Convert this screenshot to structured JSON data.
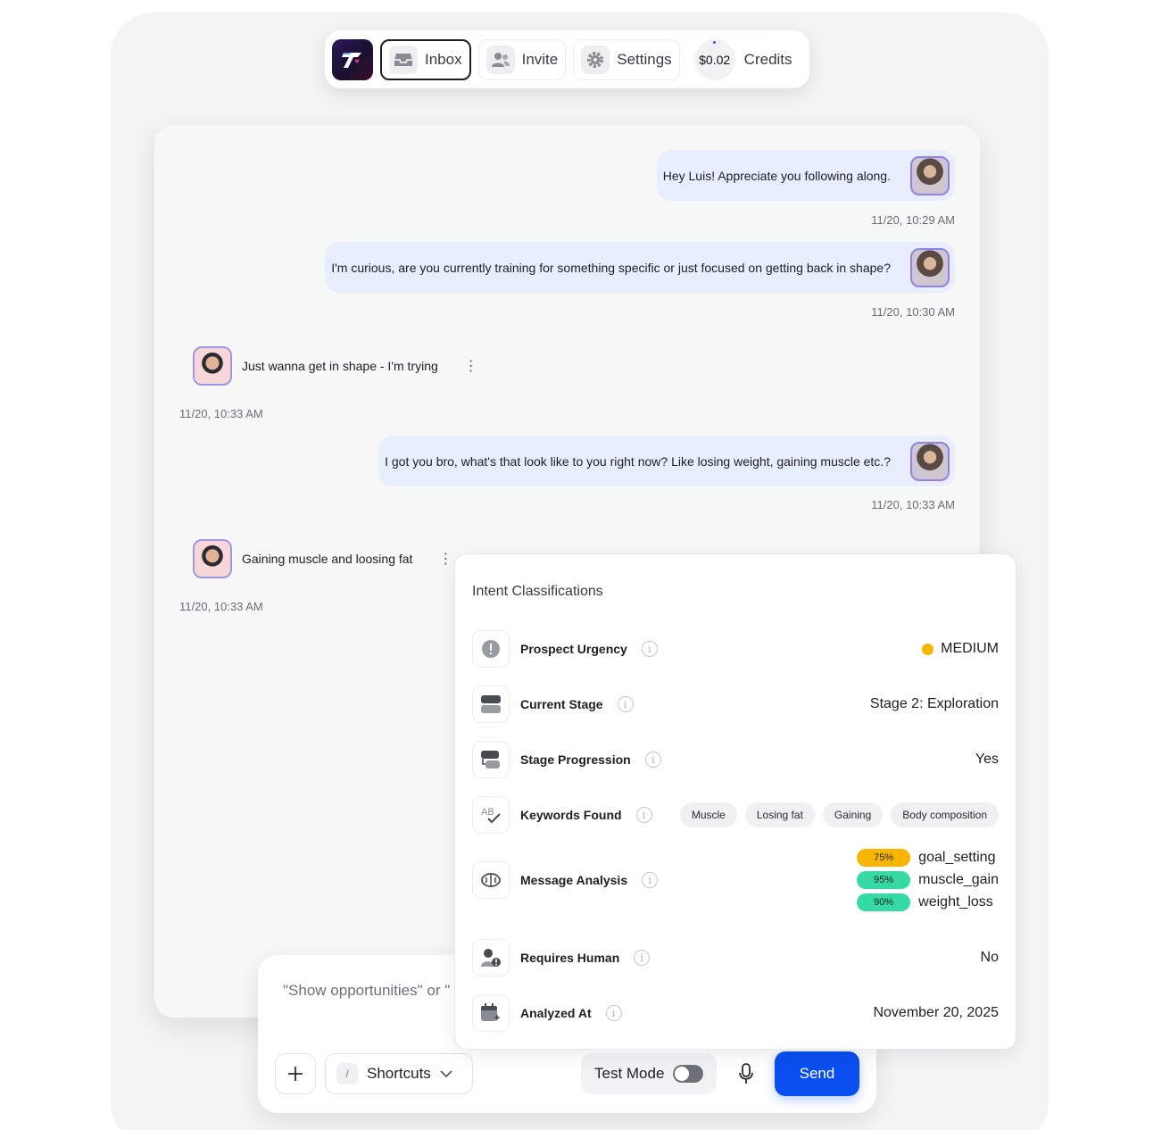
{
  "nav": {
    "inbox_label": "Inbox",
    "invite_label": "Invite",
    "settings_label": "Settings",
    "credit_value": "$0.02",
    "credits_label": "Credits"
  },
  "messages": [
    {
      "direction": "outgoing",
      "text": "Hey Luis! Appreciate you following along.",
      "time": "11/20, 10:29 AM"
    },
    {
      "direction": "outgoing",
      "text": "I'm curious, are you currently training for something specific or just focused on getting back in shape?",
      "time": "11/20, 10:30 AM"
    },
    {
      "direction": "incoming",
      "text": "Just wanna get in shape - I'm trying",
      "time": "11/20, 10:33 AM"
    },
    {
      "direction": "outgoing",
      "text": "I got you bro, what's that look like to you right now? Like losing weight, gaining muscle etc.?",
      "time": "11/20, 10:33 AM"
    },
    {
      "direction": "incoming",
      "text": "Gaining muscle and loosing fat",
      "time": "11/20, 10:33 AM"
    }
  ],
  "composer": {
    "placeholder": "\"Show opportunities\" or \"",
    "shortcut_key": "/",
    "shortcuts_label": "Shortcuts",
    "test_mode_label": "Test Mode",
    "test_mode_on": false,
    "send_label": "Send"
  },
  "intent": {
    "title": "Intent Classifications",
    "urgency_label": "Prospect Urgency",
    "urgency_value": "MEDIUM",
    "urgency_color": "#f7b500",
    "stage_label": "Current Stage",
    "stage_value": "Stage 2: Exploration",
    "progression_label": "Stage Progression",
    "progression_value": "Yes",
    "keywords_label": "Keywords Found",
    "keywords": [
      "Muscle",
      "Losing fat",
      "Gaining",
      "Body composition"
    ],
    "analysis_label": "Message Analysis",
    "analysis": [
      {
        "pct": "75%",
        "label": "goal_setting",
        "color": "#f7b500"
      },
      {
        "pct": "95%",
        "label": "muscle_gain",
        "color": "#34d9a4"
      },
      {
        "pct": "90%",
        "label": "weight_loss",
        "color": "#34d9a4"
      }
    ],
    "human_label": "Requires Human",
    "human_value": "No",
    "analyzed_label": "Analyzed At",
    "analyzed_value": "November 20, 2025"
  },
  "colors": {
    "accent": "#0a4ef0",
    "bubble": "#e9eefe"
  }
}
